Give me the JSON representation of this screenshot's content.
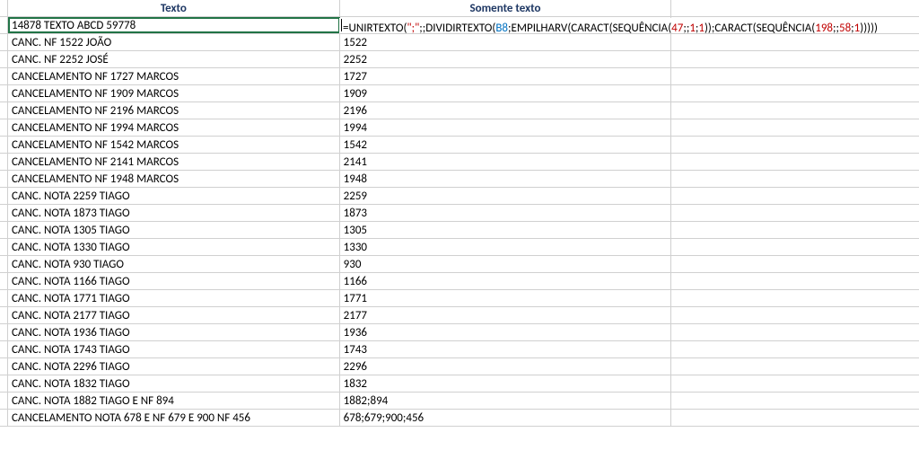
{
  "headers": {
    "texto": "Texto",
    "somente": "Somente texto"
  },
  "formula": {
    "eq": "=",
    "f1": "UNIRTEXTO",
    "p1": "(",
    "arg_str": "\";\"",
    "sep1": ";;",
    "f2": "DIVIDIRTEXTO",
    "p2": "(",
    "ref": "B8",
    "sep2": ";",
    "f3": "EMPILHARV",
    "p3": "(",
    "f4": "CARACT",
    "p4": "(",
    "f5": "SEQUÊNCIA",
    "p5": "(",
    "n47": "47",
    "sep3": ";;",
    "n1a": "1",
    "sep4": ";",
    "n1b": "1",
    "close1": "))",
    "sep5": ";",
    "f6": "CARACT",
    "p6": "(",
    "f7": "SEQUÊNCIA",
    "p7": "(",
    "n198": "198",
    "sep6": ";;",
    "n58": "58",
    "sep7": ";",
    "n1c": "1",
    "close2": ")))))"
  },
  "rows": [
    {
      "texto": "14878 TEXTO ABCD 59778",
      "somente": ""
    },
    {
      "texto": "CANC. NF 1522 JOÃO",
      "somente": "1522"
    },
    {
      "texto": "CANC. NF 2252 JOSÉ",
      "somente": "2252"
    },
    {
      "texto": "CANCELAMENTO NF 1727 MARCOS",
      "somente": "1727"
    },
    {
      "texto": "CANCELAMENTO NF 1909 MARCOS",
      "somente": "1909"
    },
    {
      "texto": "CANCELAMENTO NF 2196 MARCOS",
      "somente": "2196"
    },
    {
      "texto": "CANCELAMENTO NF 1994 MARCOS",
      "somente": "1994"
    },
    {
      "texto": "CANCELAMENTO NF 1542 MARCOS",
      "somente": "1542"
    },
    {
      "texto": "CANCELAMENTO NF 2141 MARCOS",
      "somente": "2141"
    },
    {
      "texto": "CANCELAMENTO NF 1948 MARCOS",
      "somente": "1948"
    },
    {
      "texto": "CANC. NOTA 2259 TIAGO",
      "somente": "2259"
    },
    {
      "texto": "CANC. NOTA 1873 TIAGO",
      "somente": "1873"
    },
    {
      "texto": "CANC. NOTA 1305 TIAGO",
      "somente": "1305"
    },
    {
      "texto": "CANC. NOTA 1330 TIAGO",
      "somente": "1330"
    },
    {
      "texto": "CANC. NOTA 930 TIAGO",
      "somente": "930"
    },
    {
      "texto": "CANC. NOTA 1166 TIAGO",
      "somente": "1166"
    },
    {
      "texto": "CANC. NOTA 1771 TIAGO",
      "somente": "1771"
    },
    {
      "texto": "CANC. NOTA 2177 TIAGO",
      "somente": "2177"
    },
    {
      "texto": "CANC. NOTA 1936 TIAGO",
      "somente": "1936"
    },
    {
      "texto": "CANC. NOTA 1743 TIAGO",
      "somente": "1743"
    },
    {
      "texto": "CANC. NOTA 2296 TIAGO",
      "somente": "2296"
    },
    {
      "texto": "CANC. NOTA 1832 TIAGO",
      "somente": "1832"
    },
    {
      "texto": "CANC. NOTA 1882 TIAGO E NF 894",
      "somente": "1882;894"
    },
    {
      "texto": "CANCELAMENTO NOTA 678 E NF 679 E 900   NF  456",
      "somente": "678;679;900;456"
    }
  ]
}
